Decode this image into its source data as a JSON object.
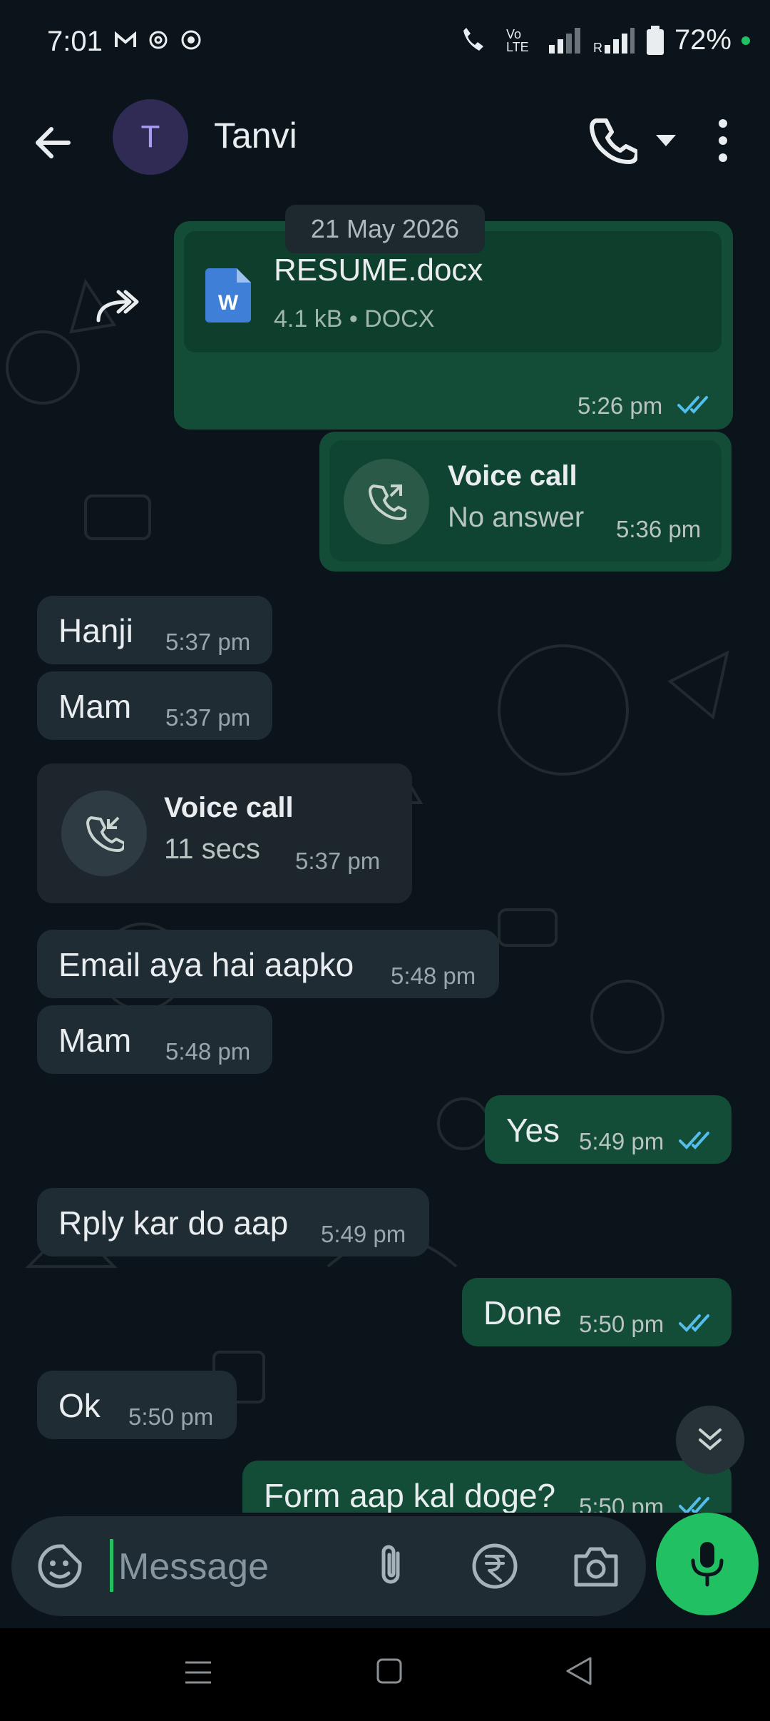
{
  "status_bar": {
    "time": "7:01",
    "battery": "72%",
    "network": "Vo LTE"
  },
  "header": {
    "avatar_letter": "T",
    "contact_name": "Tanvi"
  },
  "date_chip": "21 May 2026",
  "messages": {
    "doc": {
      "file_name": "RESUME.docx",
      "meta": "4.1 kB • DOCX",
      "time": "5:26 pm",
      "doc_letter": "W"
    },
    "call_out": {
      "title": "Voice call",
      "subtitle": "No answer",
      "time": "5:36 pm"
    },
    "m1": {
      "text": "Hanji",
      "time": "5:37 pm"
    },
    "m2": {
      "text": "Mam",
      "time": "5:37 pm"
    },
    "call_in": {
      "title": "Voice call",
      "subtitle": "11 secs",
      "time": "5:37 pm"
    },
    "m3": {
      "text": "Email aya hai aapko",
      "time": "5:48 pm"
    },
    "m4": {
      "text": "Mam",
      "time": "5:48 pm"
    },
    "m5": {
      "text": "Yes",
      "time": "5:49 pm"
    },
    "m6": {
      "text": "Rply kar do aap",
      "time": "5:49 pm"
    },
    "m7": {
      "text": "Done",
      "time": "5:50 pm"
    },
    "m8": {
      "text": "Ok",
      "time": "5:50 pm"
    },
    "m9": {
      "text": "Form aap kal doge?",
      "time": "5:50 pm"
    }
  },
  "input": {
    "placeholder": "Message"
  },
  "colors": {
    "accent": "#21c063",
    "outgoing_bubble": "#134d37",
    "incoming_bubble": "#202c33",
    "read_ticks": "#53bdeb"
  }
}
